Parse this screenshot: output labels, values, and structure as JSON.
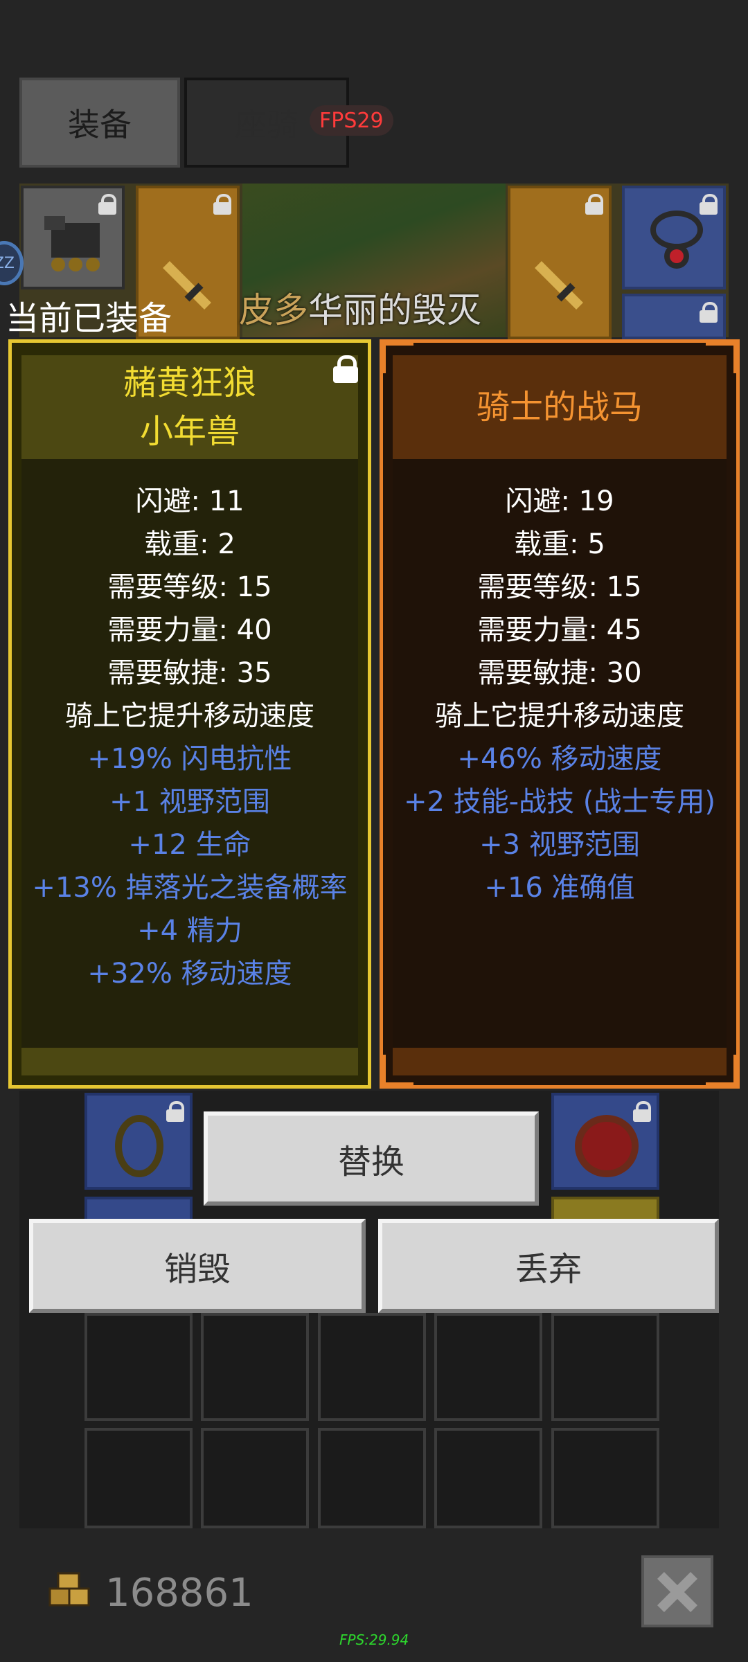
{
  "tabs": [
    {
      "label": "装备",
      "active": true
    },
    {
      "label": "座骑",
      "active": false
    }
  ],
  "fps_badge": "FPS29",
  "status_zz": "ZZ",
  "scene_title": {
    "prefix": "皮多",
    "main": "华丽的毁灭"
  },
  "current_equipped_label": "当前已装备",
  "left_card": {
    "name_line1": "赭黄狂狼",
    "name_line2": "小年兽",
    "border_color": "#e6c732",
    "stats": [
      "闪避: 11",
      "载重: 2",
      "需要等级: 15",
      "需要力量: 40",
      "需要敏捷: 35",
      "骑上它提升移动速度"
    ],
    "bonuses": [
      "+19% 闪电抗性",
      "+1 视野范围",
      "+12 生命",
      "+13% 掉落光之装备概率",
      "+4 精力",
      "+32% 移动速度"
    ]
  },
  "right_card": {
    "name": "骑士的战马",
    "border_color": "#e8812a",
    "stats": [
      "闪避: 19",
      "载重: 5",
      "需要等级: 15",
      "需要力量: 45",
      "需要敏捷: 30",
      "骑上它提升移动速度"
    ],
    "bonuses": [
      "+46% 移动速度",
      "+2 技能-战技 (战士专用)",
      "+3 视野范围",
      "+16 准确值"
    ]
  },
  "buttons": {
    "replace": "替换",
    "destroy": "销毁",
    "discard": "丢弃"
  },
  "coins": "168861",
  "fps_footer": "FPS:29.94",
  "colors": {
    "bonus_text": "#5a82e6",
    "legendary_orange": "#f49331",
    "rare_yellow": "#f2dc32"
  }
}
